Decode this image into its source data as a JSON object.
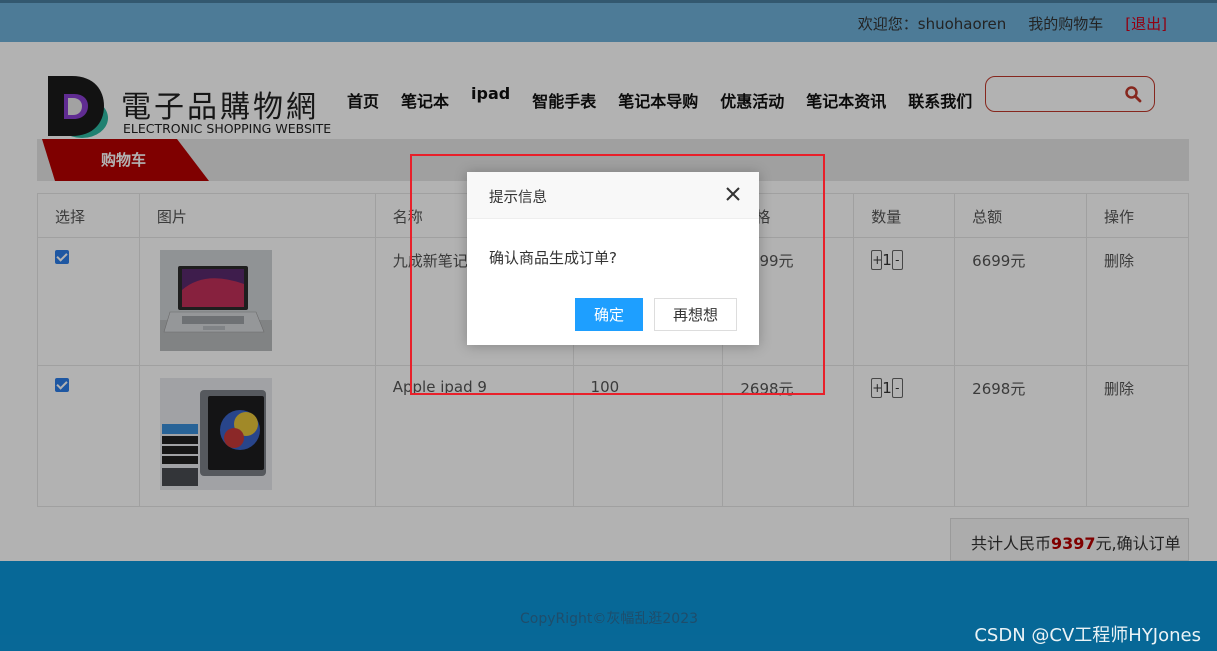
{
  "topbar": {
    "welcome": "欢迎您：shuohaoren",
    "my_cart": "我的购物车",
    "logout": "[退出]"
  },
  "logo": {
    "cn": "電子品購物網",
    "en": "ELECTRONIC SHOPPING WEBSITE"
  },
  "nav": [
    "首页",
    "笔记本",
    "ipad",
    "智能手表",
    "笔记本导购",
    "优惠活动",
    "笔记本资讯",
    "联系我们"
  ],
  "search": {
    "placeholder": "",
    "icon": "search-icon"
  },
  "cart_strip": {
    "label": "购物车"
  },
  "table": {
    "headers": [
      "选择",
      "图片",
      "名称",
      "价格",
      "数量",
      "总额",
      "操作"
    ],
    "rows": [
      {
        "checked": true,
        "image": "laptop-photo",
        "name": "九成新笔记本",
        "stock": "",
        "price": "6699元",
        "qty": "1",
        "total": "6699元",
        "action": "删除"
      },
      {
        "checked": true,
        "image": "ipad-photo",
        "name": "Apple ipad 9",
        "stock": "100",
        "price": "2698元",
        "qty": "1",
        "total": "2698元",
        "action": "删除"
      }
    ],
    "qty_plus": "+",
    "qty_minus": "-"
  },
  "total": {
    "prefix": "共计人民币",
    "amount": "9397",
    "suffix": "元,确认订单"
  },
  "footer": {
    "copyright": "CopyRight©灰幅乱逛2023",
    "watermark": "CSDN @CV工程师HYJones"
  },
  "dialog": {
    "title": "提示信息",
    "message": "确认商品生成订单?",
    "ok": "确定",
    "cancel": "再想想"
  },
  "colors": {
    "accent": "#1e9fff",
    "brand_red": "#b70000",
    "highlight_box": "#e8202a",
    "footer_blue": "#0b95d9"
  }
}
